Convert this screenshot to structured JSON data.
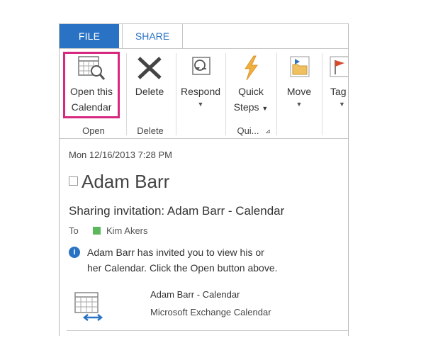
{
  "tabs": [
    {
      "label": "FILE",
      "active": false
    },
    {
      "label": "SHARE",
      "active": true
    }
  ],
  "ribbon": {
    "open_calendar": {
      "line1": "Open this",
      "line2": "Calendar",
      "icon": "calendar-search-icon"
    },
    "delete": {
      "label": "Delete",
      "icon": "x-delete-icon"
    },
    "respond": {
      "label": "Respond",
      "icon": "respond-icon"
    },
    "quick_steps": {
      "line1": "Quick",
      "line2": "Steps",
      "icon": "lightning-icon"
    },
    "move": {
      "label": "Move",
      "icon": "move-folder-icon"
    },
    "tags": {
      "label": "Tag",
      "icon": "flag-icon"
    },
    "groups": {
      "open": "Open",
      "delete": "Delete",
      "quick": "Qui..."
    }
  },
  "message": {
    "date": "Mon 12/16/2013 7:28 PM",
    "sender": "Adam Barr",
    "subject": "Sharing invitation: Adam Barr - Calendar",
    "to_label": "To",
    "recipient": "Kim Akers",
    "info_line1": "Adam Barr has invited you to view his or",
    "info_line2": "her Calendar.  Click the Open button above.",
    "attachment_title": "Adam Barr - Calendar",
    "attachment_subtitle": "Microsoft Exchange Calendar"
  },
  "colors": {
    "accent": "#2a72c4",
    "highlight": "#d6287f",
    "status_green": "#5cb85c"
  }
}
